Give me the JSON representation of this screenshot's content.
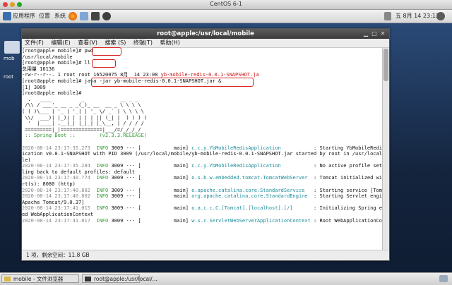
{
  "vm_title": "CentOS 6-1",
  "panel": {
    "apps": "应用程序",
    "places": "位置",
    "system": "系统",
    "clock": "五 8月 14 23:13"
  },
  "desktop": {
    "icon1_label": "mob",
    "icon2_label": "root"
  },
  "window": {
    "title": "root@apple:/usr/local/mobile",
    "menu": [
      "文件(F)",
      "编辑(E)",
      "查看(V)",
      "搜索 (S)",
      "终端(T)",
      "帮助(H)"
    ],
    "status": "1 项，剩余空间：11.8 GB"
  },
  "terminal": {
    "lines": [
      {
        "t": "[root@apple mobile]# pwd",
        "c": ""
      },
      {
        "t": "/usr/local/mobile",
        "c": ""
      },
      {
        "t": "[root@apple mobile]# ll",
        "c": ""
      },
      {
        "t": "总用量 16136",
        "c": ""
      },
      {
        "t": "-rw-r--r--. 1 root root 16520075 8月  14 23:08 ",
        "c": "",
        "extra": "yb-mobile-redis-0.0.1-SNAPSHOT.ja"
      },
      {
        "t": "[root@apple mobile]# java -jar yb-mobile-redis-0.0.1-SNAPSHOT.jar &",
        "c": ""
      },
      {
        "t": "[1] 3009",
        "c": ""
      },
      {
        "t": "[root@apple mobile]#",
        "c": ""
      },
      {
        "t": "  .   ____          _            __ _ _",
        "c": ""
      },
      {
        "t": " /\\\\ / ___'_ __ _ _(_)_ __  __ _ \\ \\ \\ \\",
        "c": ""
      },
      {
        "t": "( ( )\\___ | '_ | '_| | '_ \\/ _` | \\ \\ \\ \\",
        "c": ""
      },
      {
        "t": " \\\\/  ___)| |_)| | | | | || (_| |  ) ) ) )",
        "c": ""
      },
      {
        "t": "  '  |____| .__|_| |_|_| |_\\__, | / / / /",
        "c": ""
      },
      {
        "t": " =========|_|==============|___/=/_/_/_/",
        "c": ""
      },
      {
        "t": " :: Spring Boot ::        (v2.3.3.RELEASE)",
        "c": "grn"
      },
      {
        "t": "",
        "c": ""
      },
      {
        "t": "2020-08-14 23:17:35.273  INFO 3009 --- [           main] c.c.y.YbMobileRedisApplication           : Starting YbMobileRedisAppl",
        "c": "log"
      },
      {
        "t": "ication v0.0.1-SNAPSHOT with PID 3009 (/usr/local/mobile/yb-mobile-redis-0.0.1-SNAPSHOT.jar started by root in /usr/local/mobi",
        "c": ""
      },
      {
        "t": "le)",
        "c": ""
      },
      {
        "t": "2020-08-14 23:17:35.284  INFO 3009 --- [           main] c.c.y.YbMobileRedisApplication           : No active profile set, fal",
        "c": "log"
      },
      {
        "t": "ling back to default profiles: default",
        "c": ""
      },
      {
        "t": "2020-08-14 23:17:40.774  INFO 3009 --- [           main] o.s.b.w.embedded.tomcat.TomcatWebServer  : Tomcat initialized with po",
        "c": "log"
      },
      {
        "t": "rt(s): 8080 (http)",
        "c": ""
      },
      {
        "t": "2020-08-14 23:17:40.802  INFO 3009 --- [           main] o.apache.catalina.core.StandardService   : Starting service [Tomcat]",
        "c": "log"
      },
      {
        "t": "2020-08-14 23:17:40.802  INFO 3009 --- [           main] org.apache.catalina.core.StandardEngine  : Starting Servlet engine: [",
        "c": "log"
      },
      {
        "t": "Apache Tomcat/9.0.37]",
        "c": ""
      },
      {
        "t": "2020-08-14 23:17:41.015  INFO 3009 --- [           main] o.a.c.c.C.[Tomcat].[localhost].[/]       : Initializing Spring embedd",
        "c": "log"
      },
      {
        "t": "ed WebApplicationContext",
        "c": ""
      },
      {
        "t": "2020-08-14 23:17:41.017  INFO 3009 --- [           main] w.s.c.ServletWebServerApplicationContext : Root WebApplicationContext",
        "c": "log"
      }
    ]
  },
  "taskbar": {
    "task1": "mobile - 文件浏览器",
    "task2": "root@apple:/usr/local/..."
  },
  "colors": {
    "highlight": "#dd2222",
    "spring": "#339933",
    "info": "#339933",
    "logger": "#1b8c9a"
  }
}
